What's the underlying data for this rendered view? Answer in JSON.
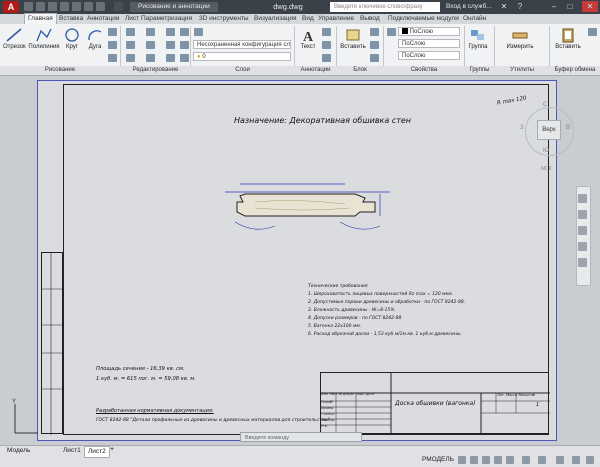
{
  "titlebar": {
    "logo": "A",
    "workspace": "Рисование и аннотации",
    "document_title": "dwg.dwg",
    "search_placeholder": "Введите ключевое слово/фразу",
    "signin": "Вход в служб..."
  },
  "tabs": [
    "Главная",
    "Вставка",
    "Аннотации",
    "Лист",
    "Параметризация",
    "3D инструменты",
    "Визуализация",
    "Вид",
    "Управление",
    "Вывод",
    "Подключаемые модули",
    "Онлайн"
  ],
  "active_tab": "Главная",
  "ribbon": {
    "draw_tools": [
      "Отрезок",
      "Полилиния",
      "Круг",
      "Дуга"
    ],
    "layer_combo": "Несохраненная конфигурация сло",
    "layer_value": "0",
    "text_label": "Текст",
    "insert_label": "Вставить",
    "properties": {
      "color": "ПоСлою",
      "linetype": "ПоСлою",
      "lineweight": "ПоСлою"
    },
    "group_label": "Группа",
    "measure_label": "Измерить",
    "paste_label": "Вставить",
    "panels": [
      "Рисование",
      "Редактирование",
      "Слои",
      "Аннотации",
      "Блок",
      "Свойства",
      "Группы",
      "Утилиты",
      "Буфер обмена"
    ]
  },
  "drawing": {
    "heading": "Назначение: Декоративная обшивка стен",
    "roughness": "R max 120",
    "notes_title": "Технические требования",
    "notes": [
      "1. Шероховатость лицевых поверхностей Rz max = 120 мкм.",
      "2. Допустимые пороки древесины и обработки - по ГОСТ 8242-88.",
      "3. Влажность древесины - W=8-15%",
      "4. Допуски размеров - по ГОСТ 8242-88",
      "5. Вагонка 22х100 мм.",
      "6. Расход обрезной доски - 1,53 куб.м/1м.кв. 1 куб.м древесины."
    ],
    "area": "Площадь сечения - 16,39 кв. см.",
    "volume": "1 куб. м. = 615 пог. м. = 59,08 кв. м.",
    "design_title": "Разработанная нормативная документация:",
    "design_text": "ГОСТ 8242-88 \"Детали профильные из древесины и древесных материалов для строительства\".",
    "title_name": "Доска обшивки (вагонка)",
    "sheet_number": "1",
    "litera": "Лит.  Масса  Масштаб",
    "stamp_rows": [
      "Изм.",
      "Лист",
      "№ докум.",
      "Подп.",
      "Дата",
      "Разраб.",
      "Провер.",
      "Т.контр.",
      "Н.контр.",
      "Утв."
    ]
  },
  "viewcube": {
    "face": "Верх",
    "dirs": [
      "С",
      "В",
      "Ю",
      "З"
    ],
    "ucs": "МСК"
  },
  "cmdline": {
    "placeholder": "Введите команду"
  },
  "status": {
    "layout_tabs": [
      "Модель",
      "Лист1",
      "Лист2"
    ],
    "active_layout": "Лист2",
    "mode": "РМОДЕЛЬ"
  }
}
